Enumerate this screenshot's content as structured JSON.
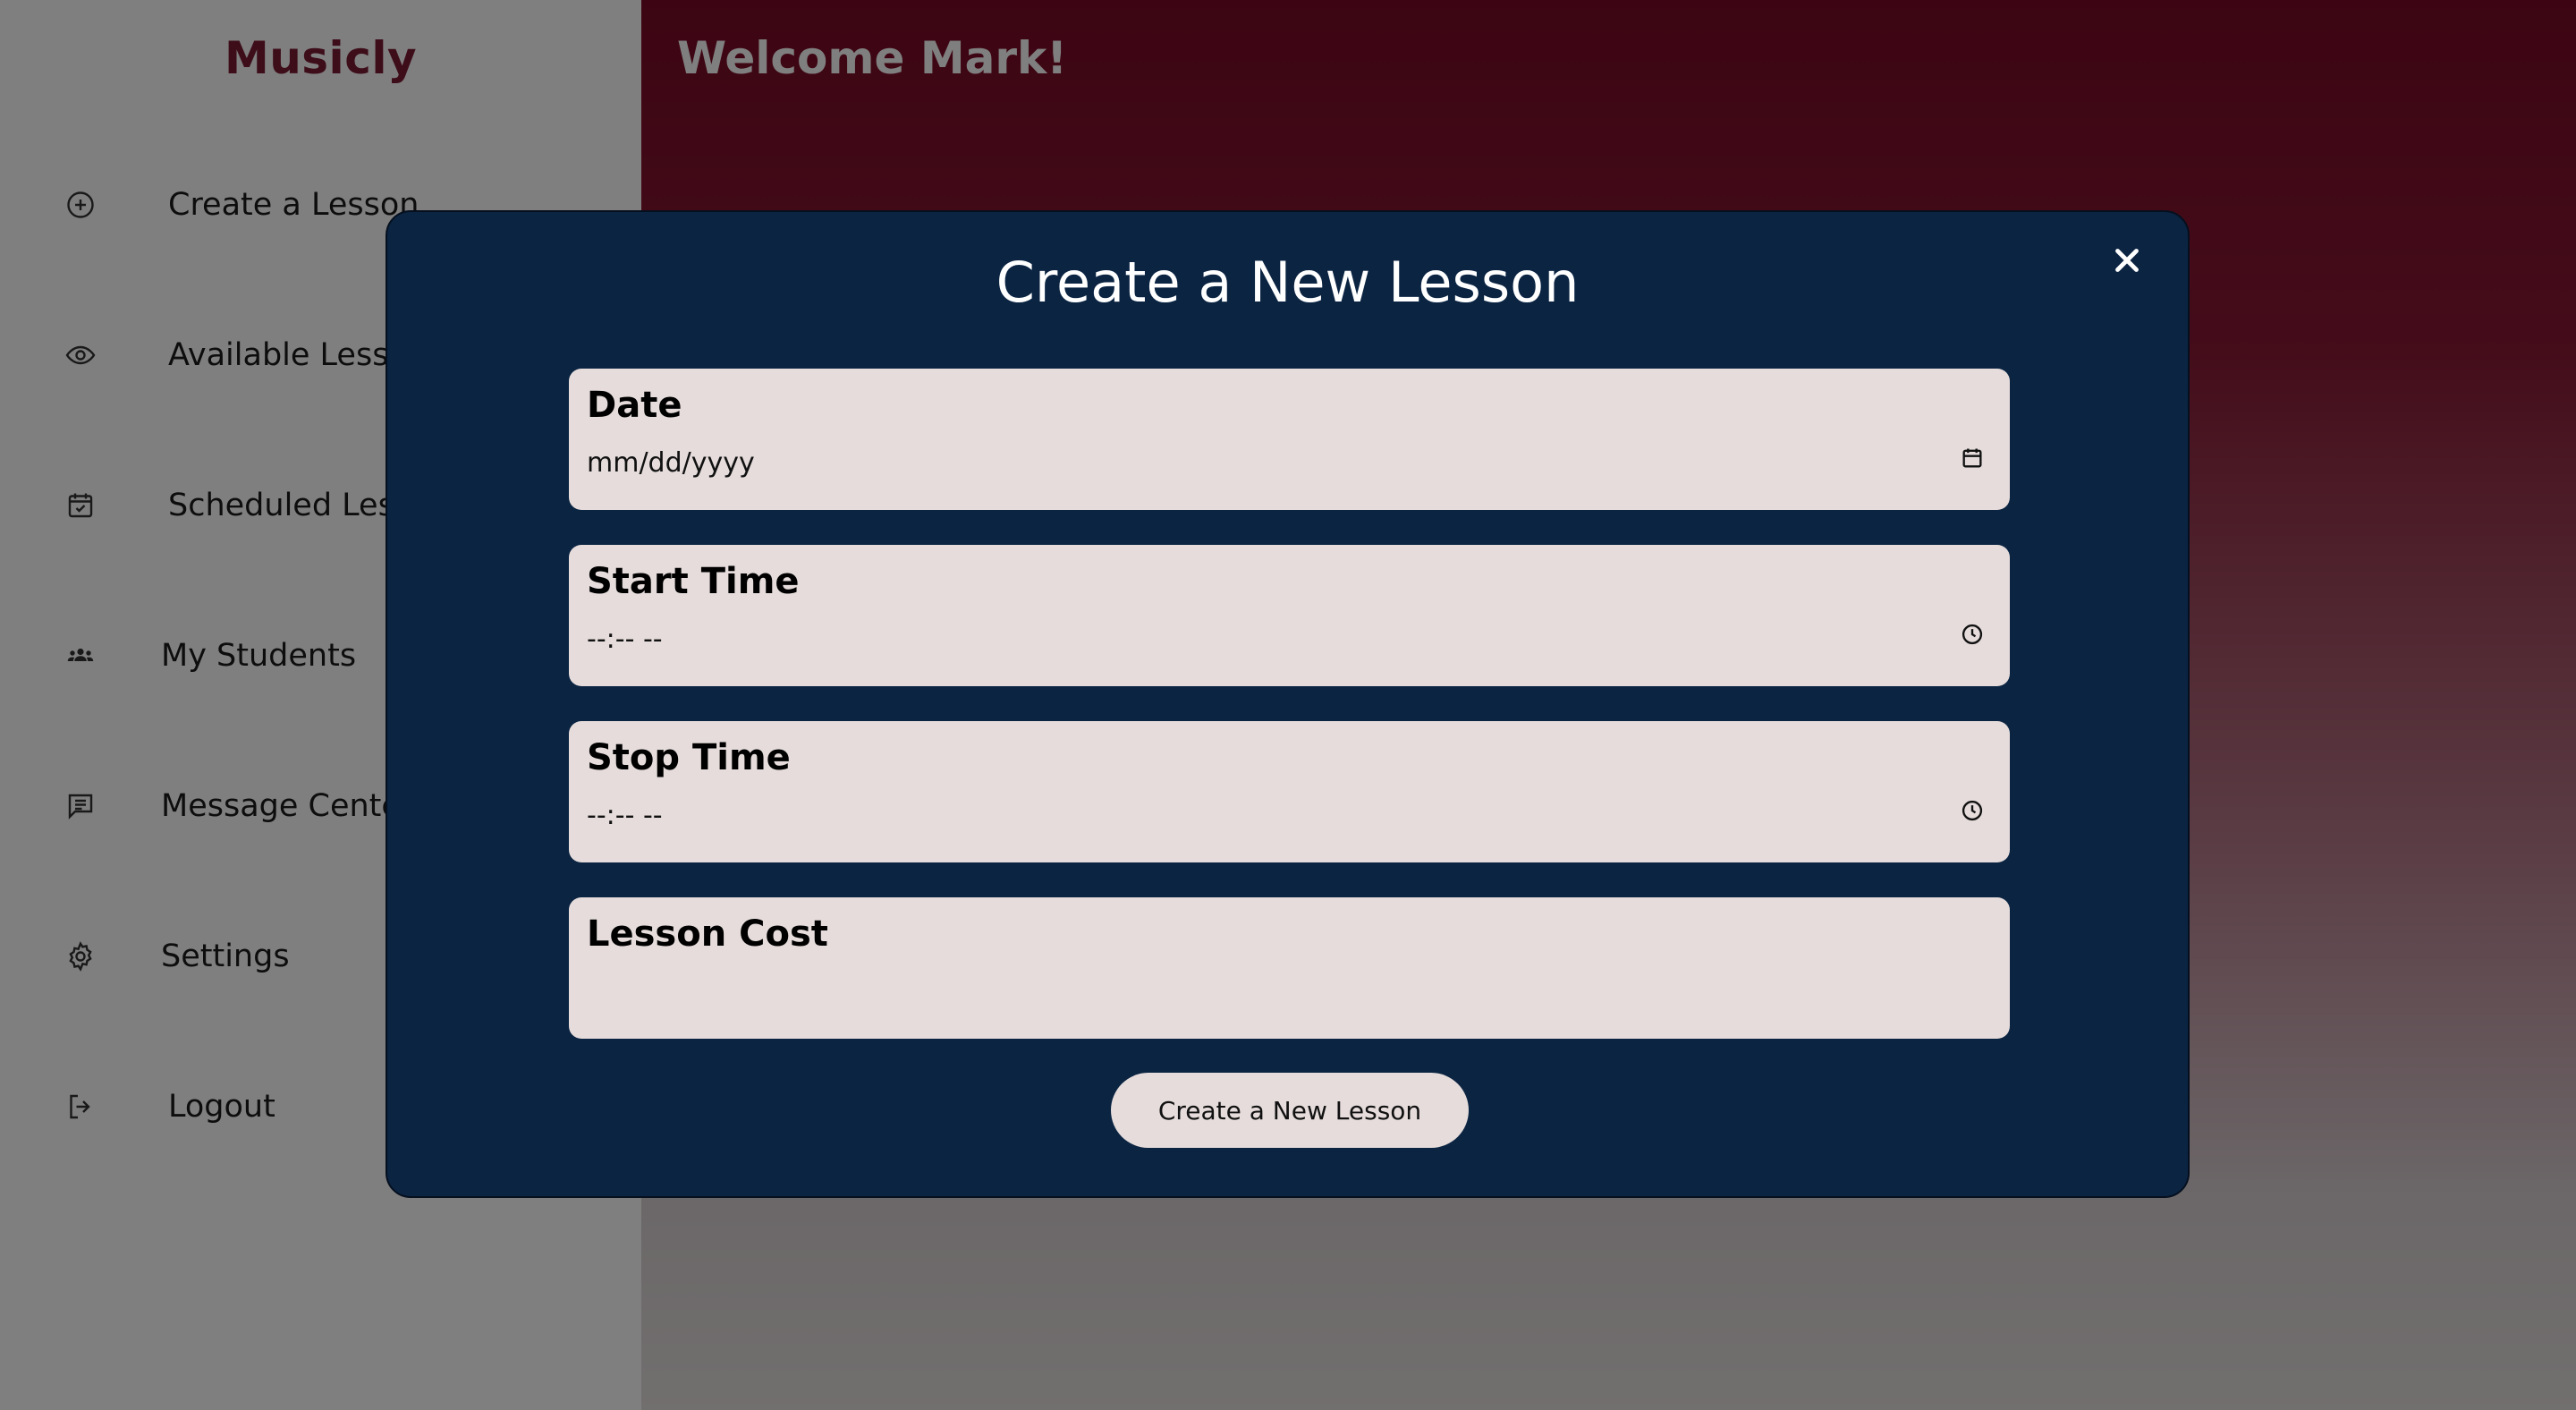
{
  "app": {
    "brand": "Musicly",
    "welcome": "Welcome Mark!"
  },
  "sidebar": {
    "items": [
      {
        "label": "Create a Lesson",
        "icon": "plus-circle-icon"
      },
      {
        "label": "Available Lessons",
        "icon": "eye-icon"
      },
      {
        "label": "Scheduled Lessons",
        "icon": "calendar-check-icon"
      },
      {
        "label": "My Students",
        "icon": "users-icon"
      },
      {
        "label": "Message Center",
        "icon": "message-icon"
      },
      {
        "label": "Settings",
        "icon": "gear-icon"
      },
      {
        "label": "Logout",
        "icon": "logout-icon"
      }
    ]
  },
  "modal": {
    "title": "Create a New Lesson",
    "close_icon": "close-icon",
    "fields": [
      {
        "label": "Date",
        "placeholder": "mm/dd/yyyy",
        "value": "",
        "icon": "calendar-icon"
      },
      {
        "label": "Start Time",
        "placeholder": "--:-- --",
        "value": "",
        "icon": "clock-icon"
      },
      {
        "label": "Stop Time",
        "placeholder": "--:-- --",
        "value": "",
        "icon": "clock-icon"
      },
      {
        "label": "Lesson Cost",
        "placeholder": "",
        "value": ""
      }
    ],
    "submit_label": "Create a New Lesson"
  },
  "colors": {
    "brand": "#7a1b34",
    "main_gradient_top": "#7a0b26",
    "modal_bg": "#0b2442",
    "field_bg": "#e5dcdb",
    "overlay": "rgba(0,0,0,0.5)"
  }
}
